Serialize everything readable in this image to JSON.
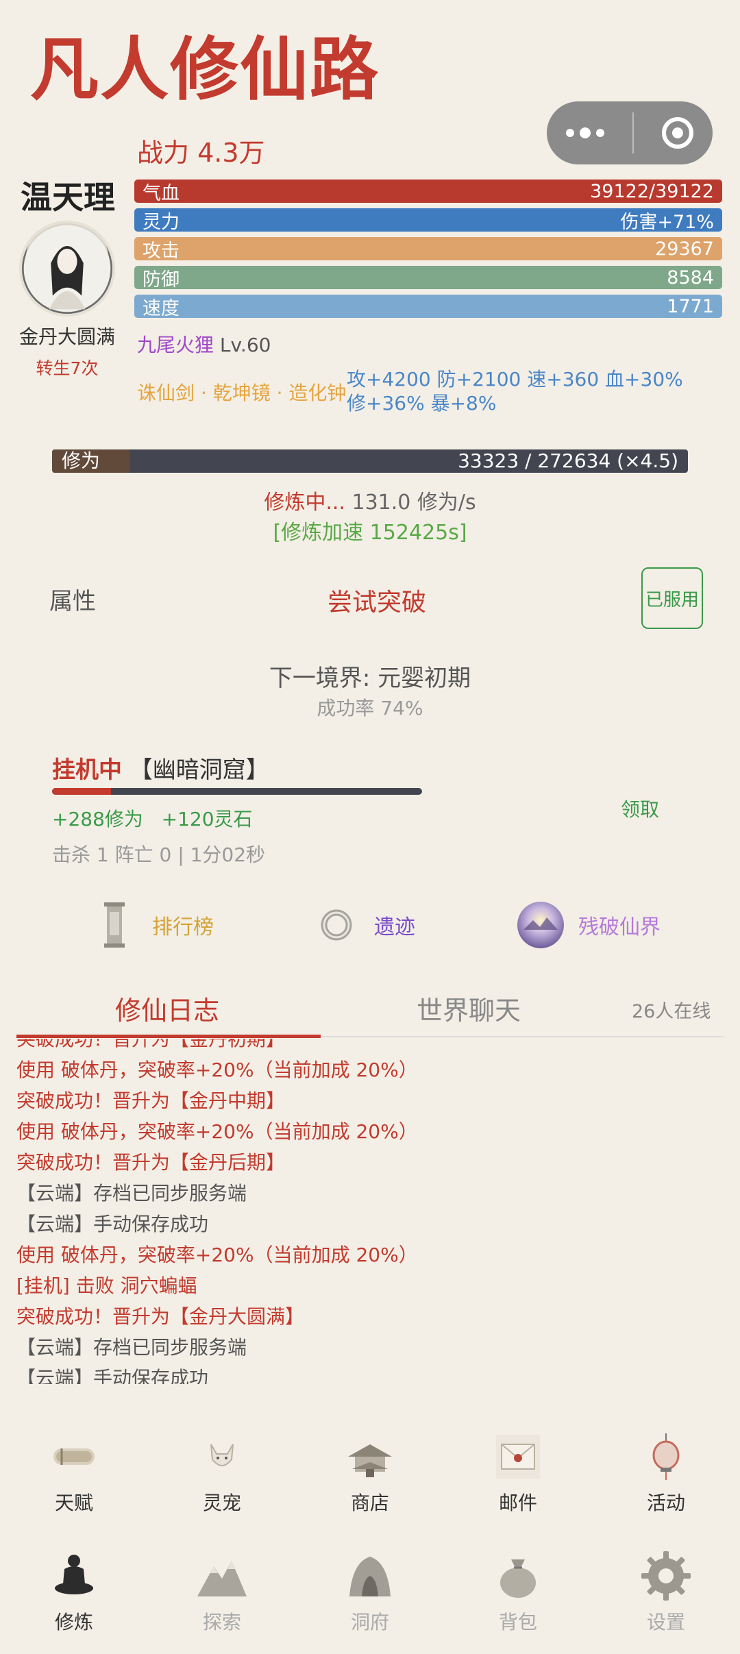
{
  "app": {
    "title": "凡人修仙路"
  },
  "player": {
    "power": "战力 4.3万",
    "name": "温天理",
    "realm": "金丹大圆满",
    "rebirth": "转生7次"
  },
  "stats": [
    {
      "label": "气血",
      "value": "39122/39122",
      "color": "#b83a2e"
    },
    {
      "label": "灵力",
      "value": "伤害+71%",
      "color": "#3f7bbf"
    },
    {
      "label": "攻击",
      "value": "29367",
      "color": "#dda36a"
    },
    {
      "label": "防御",
      "value": "8584",
      "color": "#7fa88a"
    },
    {
      "label": "速度",
      "value": "1771",
      "color": "#7ca9cf"
    }
  ],
  "pet": {
    "name": "九尾火狸",
    "level": "Lv.60"
  },
  "equipment": "诛仙剑 · 乾坤镜 · 造化钟",
  "bonus": {
    "line1": "攻+4200 防+2100 速+360 血+30%",
    "line2": "修+36% 暴+8%"
  },
  "cultivation": {
    "label": "修为",
    "value": "33323 / 272634 (×4.5)",
    "progress": 0.122
  },
  "training": {
    "status": "修炼中...",
    "rate": " 131.0 修为/s",
    "speedup": "[修炼加速 152425s]"
  },
  "actions": {
    "attributes": "属性",
    "breakthrough": "尝试突破",
    "used": "已服用"
  },
  "next": {
    "realm": "下一境界: 元婴初期",
    "rate": "成功率 74%"
  },
  "idle": {
    "status": "挂机中",
    "location": " 【幽暗洞窟】",
    "progress": 0.16,
    "gain_cultivation": "+288修为",
    "gain_stones": "+120灵石",
    "claim": "领取",
    "stats": "击杀 1  阵亡 0 | 1分02秒"
  },
  "features": [
    {
      "label": "排行榜",
      "icon": "pillar-icon",
      "color": "#d4a338"
    },
    {
      "label": "遗迹",
      "icon": "ring-icon",
      "color": "#7a4cc8"
    },
    {
      "label": "残破仙界",
      "icon": "realm-orb-icon",
      "color": "#b57ad8"
    }
  ],
  "tabs": {
    "log": "修仙日志",
    "chat": "世界聊天",
    "online": "26人在线"
  },
  "log": [
    {
      "text": "使用 破体丹，突破率+20%（当前加成 20%）",
      "tone": "r"
    },
    {
      "text": "突破成功！晋升为【金丹中期】",
      "tone": "r"
    },
    {
      "text": "使用 破体丹，突破率+20%（当前加成 20%）",
      "tone": "r"
    },
    {
      "text": "突破成功！晋升为【金丹后期】",
      "tone": "r"
    },
    {
      "text": "【云端】存档已同步服务端",
      "tone": "g"
    },
    {
      "text": "【云端】手动保存成功",
      "tone": "g"
    },
    {
      "text": "使用 破体丹，突破率+20%（当前加成 20%）",
      "tone": "r"
    },
    {
      "text": "[挂机] 击败 洞穴蝙蝠",
      "tone": "r"
    },
    {
      "text": "突破成功！晋升为【金丹大圆满】",
      "tone": "r"
    },
    {
      "text": "【云端】存档已同步服务端",
      "tone": "g"
    },
    {
      "text": "【云端】手动保存成功",
      "tone": "g"
    }
  ],
  "nav_row1": [
    {
      "label": "天赋",
      "icon": "scroll-icon"
    },
    {
      "label": "灵宠",
      "icon": "fox-icon"
    },
    {
      "label": "商店",
      "icon": "pavilion-icon"
    },
    {
      "label": "邮件",
      "icon": "envelope-icon"
    },
    {
      "label": "活动",
      "icon": "lantern-icon"
    }
  ],
  "nav_row2": [
    {
      "label": "修炼",
      "icon": "meditation-icon"
    },
    {
      "label": "探索",
      "icon": "mountain-icon"
    },
    {
      "label": "洞府",
      "icon": "cave-icon"
    },
    {
      "label": "背包",
      "icon": "bag-icon"
    },
    {
      "label": "设置",
      "icon": "gear-icon"
    }
  ]
}
